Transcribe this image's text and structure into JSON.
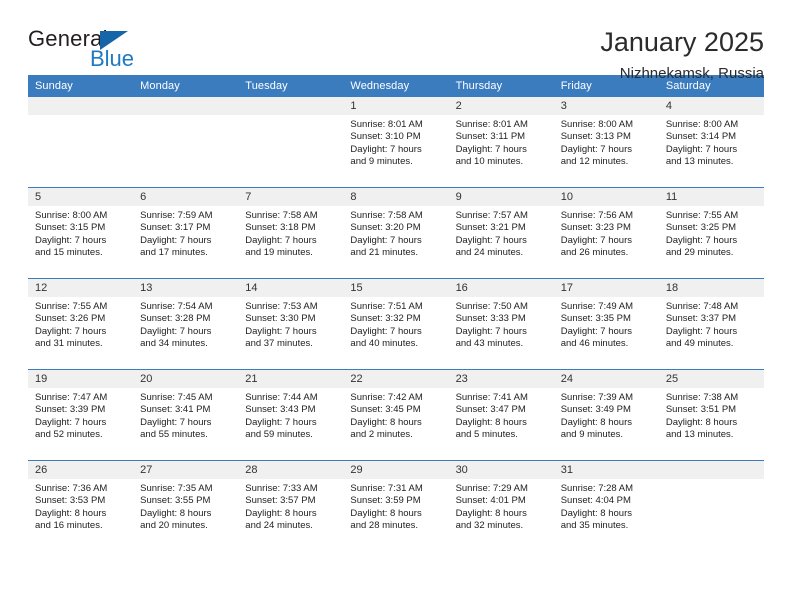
{
  "logo": {
    "word1": "General",
    "word2": "Blue",
    "triangle_color": "#1565a8",
    "blue_color": "#1e7ac4"
  },
  "header": {
    "month_title": "January 2025",
    "location": "Nizhnekamsk, Russia"
  },
  "theme": {
    "header_bg": "#3b7cbf",
    "daynum_bg": "#f0f0f0",
    "row_divider": "#3b7cbf"
  },
  "calendar": {
    "weekday_headers": [
      "Sunday",
      "Monday",
      "Tuesday",
      "Wednesday",
      "Thursday",
      "Friday",
      "Saturday"
    ],
    "weeks": [
      [
        {
          "day": "",
          "empty": true
        },
        {
          "day": "",
          "empty": true
        },
        {
          "day": "",
          "empty": true
        },
        {
          "day": "1",
          "sunrise": "Sunrise: 8:01 AM",
          "sunset": "Sunset: 3:10 PM",
          "daylight1": "Daylight: 7 hours",
          "daylight2": "and 9 minutes."
        },
        {
          "day": "2",
          "sunrise": "Sunrise: 8:01 AM",
          "sunset": "Sunset: 3:11 PM",
          "daylight1": "Daylight: 7 hours",
          "daylight2": "and 10 minutes."
        },
        {
          "day": "3",
          "sunrise": "Sunrise: 8:00 AM",
          "sunset": "Sunset: 3:13 PM",
          "daylight1": "Daylight: 7 hours",
          "daylight2": "and 12 minutes."
        },
        {
          "day": "4",
          "sunrise": "Sunrise: 8:00 AM",
          "sunset": "Sunset: 3:14 PM",
          "daylight1": "Daylight: 7 hours",
          "daylight2": "and 13 minutes."
        }
      ],
      [
        {
          "day": "5",
          "sunrise": "Sunrise: 8:00 AM",
          "sunset": "Sunset: 3:15 PM",
          "daylight1": "Daylight: 7 hours",
          "daylight2": "and 15 minutes."
        },
        {
          "day": "6",
          "sunrise": "Sunrise: 7:59 AM",
          "sunset": "Sunset: 3:17 PM",
          "daylight1": "Daylight: 7 hours",
          "daylight2": "and 17 minutes."
        },
        {
          "day": "7",
          "sunrise": "Sunrise: 7:58 AM",
          "sunset": "Sunset: 3:18 PM",
          "daylight1": "Daylight: 7 hours",
          "daylight2": "and 19 minutes."
        },
        {
          "day": "8",
          "sunrise": "Sunrise: 7:58 AM",
          "sunset": "Sunset: 3:20 PM",
          "daylight1": "Daylight: 7 hours",
          "daylight2": "and 21 minutes."
        },
        {
          "day": "9",
          "sunrise": "Sunrise: 7:57 AM",
          "sunset": "Sunset: 3:21 PM",
          "daylight1": "Daylight: 7 hours",
          "daylight2": "and 24 minutes."
        },
        {
          "day": "10",
          "sunrise": "Sunrise: 7:56 AM",
          "sunset": "Sunset: 3:23 PM",
          "daylight1": "Daylight: 7 hours",
          "daylight2": "and 26 minutes."
        },
        {
          "day": "11",
          "sunrise": "Sunrise: 7:55 AM",
          "sunset": "Sunset: 3:25 PM",
          "daylight1": "Daylight: 7 hours",
          "daylight2": "and 29 minutes."
        }
      ],
      [
        {
          "day": "12",
          "sunrise": "Sunrise: 7:55 AM",
          "sunset": "Sunset: 3:26 PM",
          "daylight1": "Daylight: 7 hours",
          "daylight2": "and 31 minutes."
        },
        {
          "day": "13",
          "sunrise": "Sunrise: 7:54 AM",
          "sunset": "Sunset: 3:28 PM",
          "daylight1": "Daylight: 7 hours",
          "daylight2": "and 34 minutes."
        },
        {
          "day": "14",
          "sunrise": "Sunrise: 7:53 AM",
          "sunset": "Sunset: 3:30 PM",
          "daylight1": "Daylight: 7 hours",
          "daylight2": "and 37 minutes."
        },
        {
          "day": "15",
          "sunrise": "Sunrise: 7:51 AM",
          "sunset": "Sunset: 3:32 PM",
          "daylight1": "Daylight: 7 hours",
          "daylight2": "and 40 minutes."
        },
        {
          "day": "16",
          "sunrise": "Sunrise: 7:50 AM",
          "sunset": "Sunset: 3:33 PM",
          "daylight1": "Daylight: 7 hours",
          "daylight2": "and 43 minutes."
        },
        {
          "day": "17",
          "sunrise": "Sunrise: 7:49 AM",
          "sunset": "Sunset: 3:35 PM",
          "daylight1": "Daylight: 7 hours",
          "daylight2": "and 46 minutes."
        },
        {
          "day": "18",
          "sunrise": "Sunrise: 7:48 AM",
          "sunset": "Sunset: 3:37 PM",
          "daylight1": "Daylight: 7 hours",
          "daylight2": "and 49 minutes."
        }
      ],
      [
        {
          "day": "19",
          "sunrise": "Sunrise: 7:47 AM",
          "sunset": "Sunset: 3:39 PM",
          "daylight1": "Daylight: 7 hours",
          "daylight2": "and 52 minutes."
        },
        {
          "day": "20",
          "sunrise": "Sunrise: 7:45 AM",
          "sunset": "Sunset: 3:41 PM",
          "daylight1": "Daylight: 7 hours",
          "daylight2": "and 55 minutes."
        },
        {
          "day": "21",
          "sunrise": "Sunrise: 7:44 AM",
          "sunset": "Sunset: 3:43 PM",
          "daylight1": "Daylight: 7 hours",
          "daylight2": "and 59 minutes."
        },
        {
          "day": "22",
          "sunrise": "Sunrise: 7:42 AM",
          "sunset": "Sunset: 3:45 PM",
          "daylight1": "Daylight: 8 hours",
          "daylight2": "and 2 minutes."
        },
        {
          "day": "23",
          "sunrise": "Sunrise: 7:41 AM",
          "sunset": "Sunset: 3:47 PM",
          "daylight1": "Daylight: 8 hours",
          "daylight2": "and 5 minutes."
        },
        {
          "day": "24",
          "sunrise": "Sunrise: 7:39 AM",
          "sunset": "Sunset: 3:49 PM",
          "daylight1": "Daylight: 8 hours",
          "daylight2": "and 9 minutes."
        },
        {
          "day": "25",
          "sunrise": "Sunrise: 7:38 AM",
          "sunset": "Sunset: 3:51 PM",
          "daylight1": "Daylight: 8 hours",
          "daylight2": "and 13 minutes."
        }
      ],
      [
        {
          "day": "26",
          "sunrise": "Sunrise: 7:36 AM",
          "sunset": "Sunset: 3:53 PM",
          "daylight1": "Daylight: 8 hours",
          "daylight2": "and 16 minutes."
        },
        {
          "day": "27",
          "sunrise": "Sunrise: 7:35 AM",
          "sunset": "Sunset: 3:55 PM",
          "daylight1": "Daylight: 8 hours",
          "daylight2": "and 20 minutes."
        },
        {
          "day": "28",
          "sunrise": "Sunrise: 7:33 AM",
          "sunset": "Sunset: 3:57 PM",
          "daylight1": "Daylight: 8 hours",
          "daylight2": "and 24 minutes."
        },
        {
          "day": "29",
          "sunrise": "Sunrise: 7:31 AM",
          "sunset": "Sunset: 3:59 PM",
          "daylight1": "Daylight: 8 hours",
          "daylight2": "and 28 minutes."
        },
        {
          "day": "30",
          "sunrise": "Sunrise: 7:29 AM",
          "sunset": "Sunset: 4:01 PM",
          "daylight1": "Daylight: 8 hours",
          "daylight2": "and 32 minutes."
        },
        {
          "day": "31",
          "sunrise": "Sunrise: 7:28 AM",
          "sunset": "Sunset: 4:04 PM",
          "daylight1": "Daylight: 8 hours",
          "daylight2": "and 35 minutes."
        },
        {
          "day": "",
          "empty": true
        }
      ]
    ]
  }
}
